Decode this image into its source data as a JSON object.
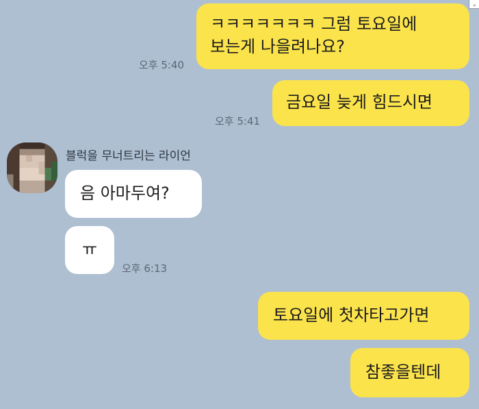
{
  "chat": {
    "messages": [
      {
        "sender": "me",
        "lines": [
          "ㅋㅋㅋㅋㅋㅋㅋ 그럼 토요일에",
          "보는게 나을려나요?"
        ],
        "time": "오후 5:40"
      },
      {
        "sender": "me",
        "text": "금요일 늦게 힘드시면",
        "time": "오후 5:41"
      },
      {
        "sender": "them",
        "name": "블럭을 무너트리는 라이언",
        "text": "음 아마두여?"
      },
      {
        "sender": "them",
        "text": "ㅠ",
        "time": "오후 6:13"
      },
      {
        "sender": "me",
        "text": "토요일에 첫차타고가면"
      },
      {
        "sender": "me",
        "text": "참좋을텐데"
      }
    ]
  },
  "icons": {
    "avatar": "blurred-profile-photo",
    "corner": "expand-icon"
  },
  "colors": {
    "background": "#aebfd2",
    "my_bubble": "#fbe34c",
    "their_bubble": "#ffffff"
  }
}
